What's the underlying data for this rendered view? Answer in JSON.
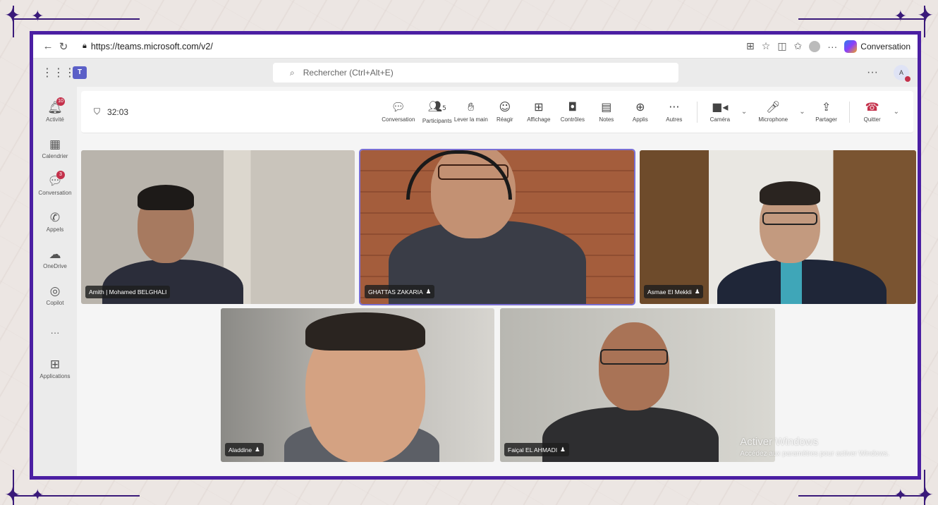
{
  "browser": {
    "url": "https://teams.microsoft.com/v2/",
    "copilot_label": "Conversation"
  },
  "teams": {
    "search_placeholder": "Rechercher (Ctrl+Alt+E)",
    "more_label": "···",
    "user_initials": "A"
  },
  "rail": {
    "items": [
      {
        "label": "Activité",
        "icon": "bell-icon",
        "badge": "10"
      },
      {
        "label": "Calendrier",
        "icon": "calendar-icon"
      },
      {
        "label": "Conversation",
        "icon": "chat-icon",
        "badge": "3"
      },
      {
        "label": "Appels",
        "icon": "phone-icon"
      },
      {
        "label": "OneDrive",
        "icon": "onedrive-icon"
      },
      {
        "label": "Copilot",
        "icon": "copilot-icon"
      },
      {
        "label": "···",
        "icon": "more-icon"
      },
      {
        "label": "Applications",
        "icon": "apps-icon"
      }
    ]
  },
  "meeting": {
    "timer": "32:03",
    "participants_count": "5",
    "tools": {
      "conversation": "Conversation",
      "participants": "Participants",
      "raise_hand": "Lever la main",
      "react": "Réagir",
      "view": "Affichage",
      "controls": "Contrôles",
      "notes": "Notes",
      "apps": "Applis",
      "more": "Autres",
      "camera": "Caméra",
      "microphone": "Microphone",
      "share": "Partager",
      "leave": "Quitter"
    },
    "participants": [
      {
        "name": "Amith | Mohamed BELGHALI"
      },
      {
        "name": "GHATTAS ZAKARIA"
      },
      {
        "name": "Asmae El Mekkli"
      },
      {
        "name": "Aladdine"
      },
      {
        "name": "Faiçal EL AHMADI"
      }
    ],
    "watermark_title": "Activer Windows",
    "watermark_sub": "Accédez aux paramètres pour activer Windows."
  },
  "colors": {
    "frame": "#4b1fa3",
    "teams_brand": "#5b5fc7",
    "hangup": "#c4314b"
  }
}
